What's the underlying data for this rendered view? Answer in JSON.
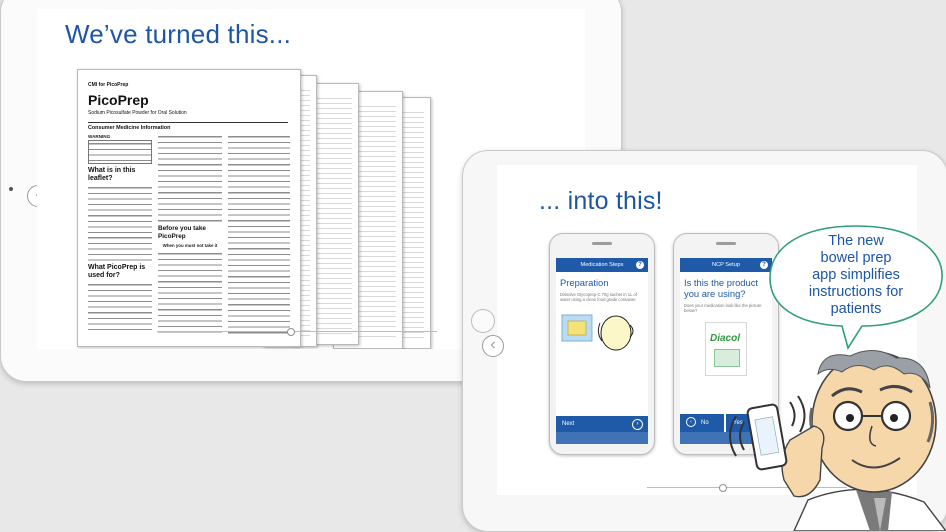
{
  "before": {
    "title": "We’ve turned this...",
    "document": {
      "header_small": "CMI for PicoPrep",
      "product_name": "PicoPrep",
      "subtitle": "Sodium Picosulfate Powder for Oral Solution",
      "section": "Consumer Medicine Information",
      "warning": "WARNING",
      "heading_1": "What is in this leaflet?",
      "heading_2": "What PicoPrep is used for?",
      "heading_3": "Before you take PicoPrep",
      "when_not": "When you must not take it"
    }
  },
  "after": {
    "title": "... into this!",
    "phone_left": {
      "bar_title": "Medication Steps",
      "heading": "Preparation",
      "text": "Dissolve Glycoprep-C 70g sachet in 1L of water using a clean food grade container.",
      "next_label": "Next"
    },
    "phone_right": {
      "bar_title": "NCP Setup",
      "heading": "Is this the product you are using?",
      "text": "Does your medication look like the picture below?",
      "product_brand": "Diacol",
      "no_label": "No",
      "yes_label": "Yes"
    }
  },
  "bubble": {
    "lines": [
      "The new",
      "bowel prep",
      "app simplifies",
      "instructions for",
      "patients"
    ]
  },
  "nav": {
    "prev_icon": "chevron-left-icon",
    "next_icon": "chevron-right-icon"
  },
  "colors": {
    "brand_blue": "#1d56a6",
    "app_blue": "#1e5aa8",
    "bubble_green": "#2f9e7a"
  }
}
